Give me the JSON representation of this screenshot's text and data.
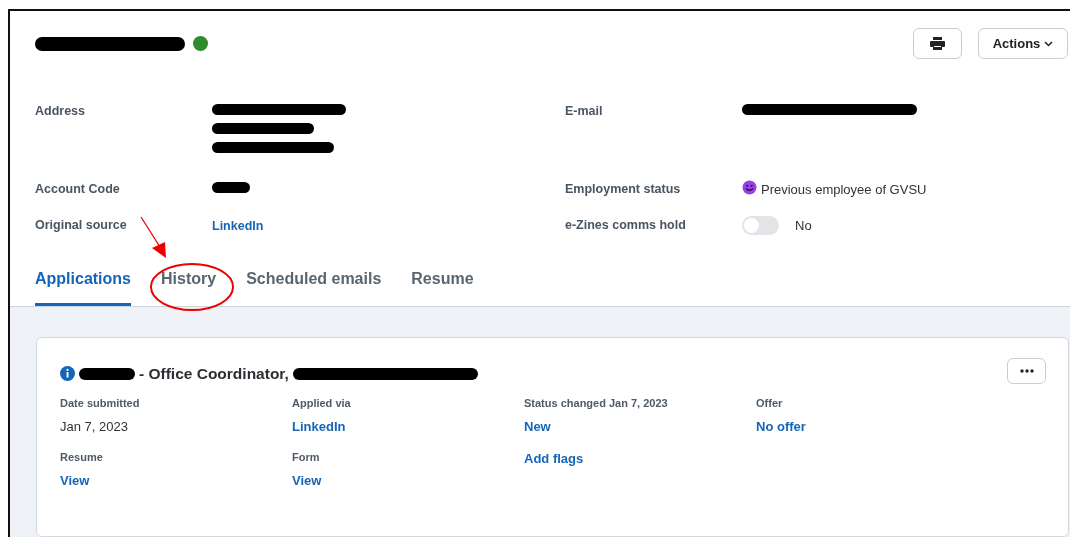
{
  "header": {
    "name": {
      "redacted": true
    },
    "online": true,
    "buttons": [
      {
        "kind": "print"
      },
      {
        "kind": "dropdown",
        "label": "Actions"
      }
    ]
  },
  "details": [
    {
      "label": "Address",
      "kind": "redacted",
      "parts": [
        {
          "redacted": true
        },
        {
          "redacted": true
        },
        {
          "redacted": true
        }
      ]
    },
    {
      "label": "E-mail",
      "kind": "redacted",
      "parts": [
        {
          "redacted": true
        }
      ]
    },
    {
      "label": "Account Code",
      "kind": "redacted",
      "parts": [
        {
          "redacted": true
        }
      ]
    },
    {
      "label": "Employment status",
      "kind": "status",
      "value": "Previous employee of GVSU"
    },
    {
      "label": "Original source",
      "kind": "link",
      "value": "LinkedIn"
    },
    {
      "label": "e-Zines comms hold",
      "kind": "toggle",
      "on": false,
      "value": "No"
    }
  ],
  "tabs": [
    {
      "label": "Applications",
      "selected": true
    },
    {
      "label": "History",
      "selected": false
    },
    {
      "label": "Scheduled emails",
      "selected": false
    },
    {
      "label": "Resume",
      "selected": false
    }
  ],
  "application": {
    "title_parts": [
      {
        "kind": "redaction"
      },
      {
        "kind": "text",
        "text": "- Office Coordinator,"
      },
      {
        "kind": "redaction"
      }
    ],
    "fields": [
      {
        "kind": "text",
        "label": "Date submitted",
        "value": "Jan 7, 2023"
      },
      {
        "kind": "link",
        "label": "Applied via",
        "value": "LinkedIn"
      },
      {
        "kind": "link",
        "label": "Status changed Jan 7, 2023",
        "value": "New"
      },
      {
        "kind": "link",
        "label": "Offer",
        "value": "No offer"
      },
      {
        "kind": "link",
        "label": "Resume",
        "value": "View"
      },
      {
        "kind": "link",
        "label": "Form",
        "value": "View"
      },
      {
        "kind": "action",
        "value": "Add flags"
      }
    ]
  },
  "annotations": {
    "arrow": true,
    "ellipse": true
  }
}
